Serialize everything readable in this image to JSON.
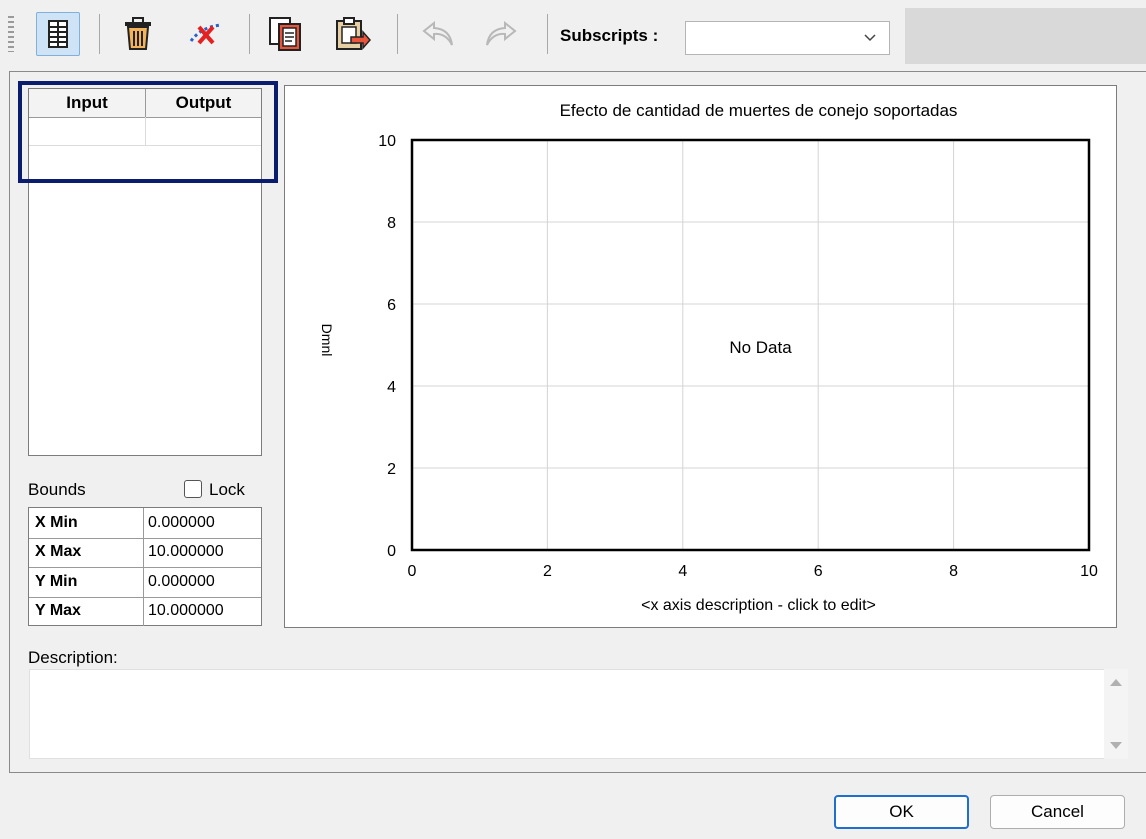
{
  "toolbar": {
    "subscripts_label": "Subscripts :",
    "subscripts_value": "",
    "icons": [
      "table-icon",
      "trash-icon",
      "clear-points-icon",
      "copy-icon",
      "paste-icon",
      "undo-icon",
      "redo-icon"
    ]
  },
  "io_table": {
    "headers": [
      "Input",
      "Output"
    ]
  },
  "bounds": {
    "label": "Bounds",
    "lock_label": "Lock",
    "lock_checked": false,
    "rows": [
      {
        "name": "X Min",
        "value": "0.000000"
      },
      {
        "name": "X Max",
        "value": "10.000000"
      },
      {
        "name": "Y Min",
        "value": "0.000000"
      },
      {
        "name": "Y Max",
        "value": "10.000000"
      }
    ]
  },
  "chart_data": {
    "type": "line",
    "title": "Efecto de cantidad de muertes de conejo soportadas",
    "xlabel": "<x axis description - click to edit>",
    "ylabel": "Dmnl",
    "xlim": [
      0,
      10
    ],
    "ylim": [
      0,
      10
    ],
    "xticks": [
      "0",
      "2",
      "4",
      "6",
      "8",
      "10"
    ],
    "yticks": [
      "0",
      "2",
      "4",
      "6",
      "8",
      "10"
    ],
    "grid": true,
    "series": [],
    "empty_message": "No Data"
  },
  "description": {
    "label": "Description:",
    "value": ""
  },
  "buttons": {
    "ok": "OK",
    "cancel": "Cancel"
  },
  "colors": {
    "highlight": "#0b1c6e",
    "ok_border": "#1f6fcf"
  }
}
